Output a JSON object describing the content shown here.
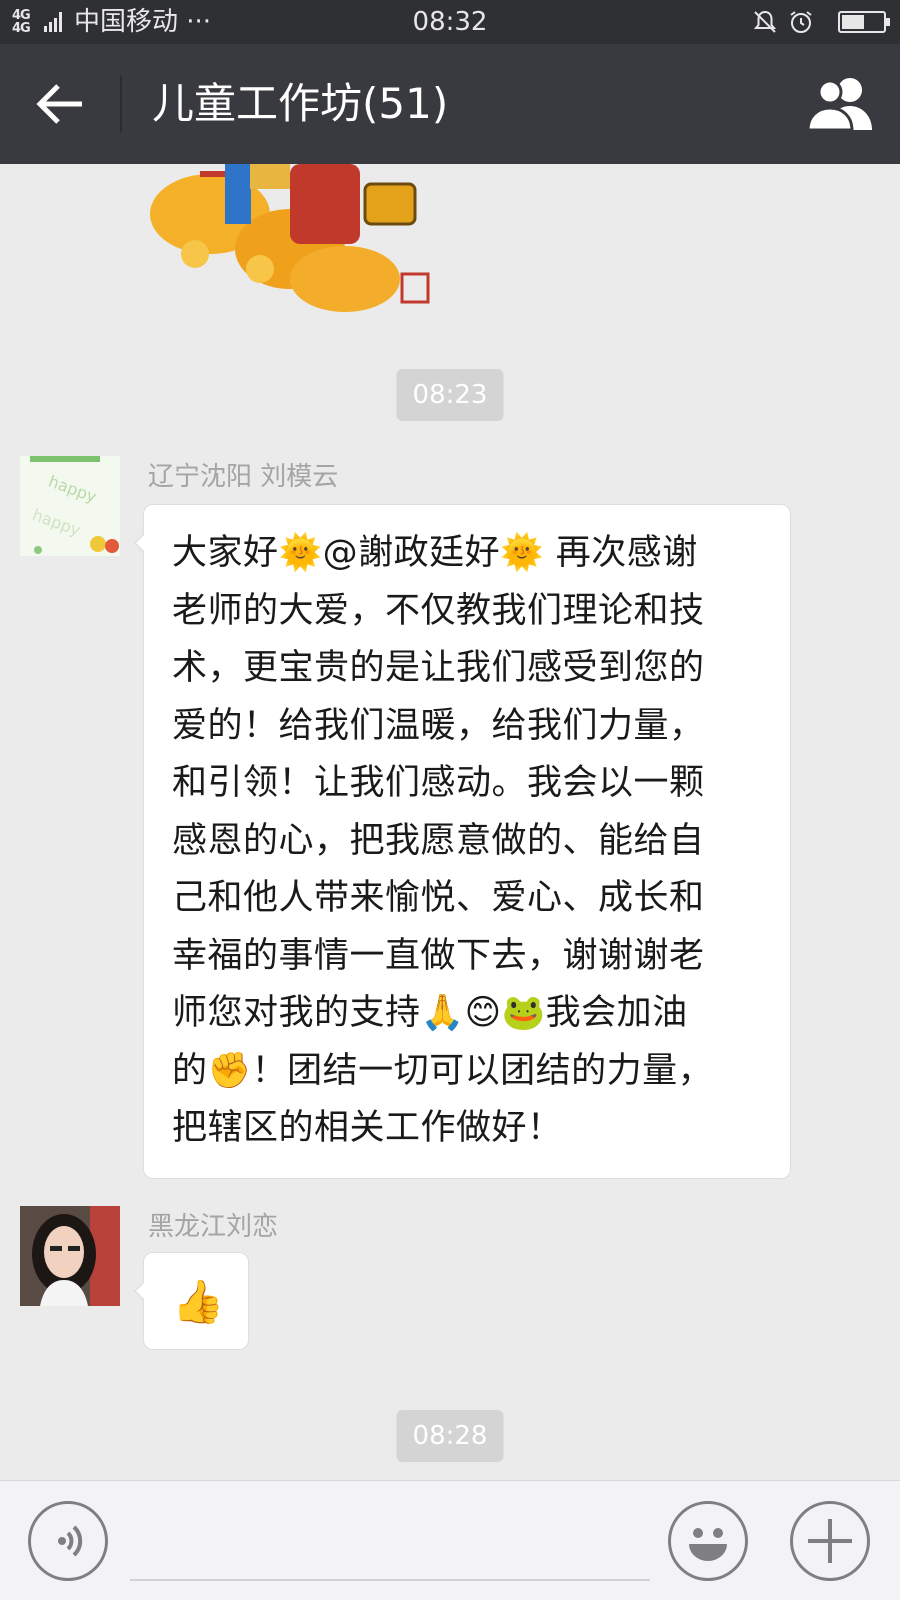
{
  "status_bar": {
    "network": "4G 4G",
    "carrier": "中国移动 ···",
    "time": "08:32",
    "battery_level": 0.5
  },
  "header": {
    "title": "儿童工作坊(51)",
    "back_icon": "arrow-left-icon",
    "members_icon": "group-members-icon"
  },
  "chat": {
    "timestamps": [
      "08:23",
      "08:28"
    ],
    "messages": [
      {
        "sender": "辽宁沈阳 刘模云",
        "lines": [
          "大家好🌞@謝政廷好🌞 再次感谢",
          "老师的大爱，不仅教我们理论和技",
          "术，更宝贵的是让我们感受到您的",
          "爱的！给我们温暖，给我们力量，",
          "和引领！让我们感动。我会以一颗",
          "感恩的心，把我愿意做的、能给自",
          "己和他人带来愉悦、爱心、成长和",
          "幸福的事情一直做下去，谢谢谢老",
          "师您对我的支持🙏😊🐸我会加油",
          "的✊！团结一切可以团结的力量，",
          "把辖区的相关工作做好！"
        ]
      },
      {
        "sender": "黑龙江刘恋",
        "content": "👍"
      }
    ]
  },
  "input_bar": {
    "voice_icon": "voice-icon",
    "emoji_icon": "smiley-icon",
    "more_icon": "plus-icon"
  }
}
